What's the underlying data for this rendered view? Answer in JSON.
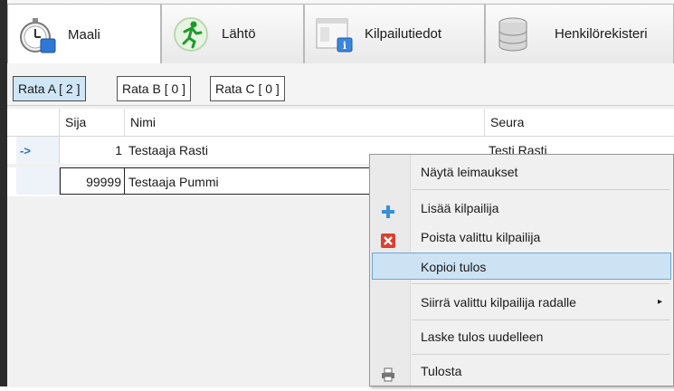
{
  "tabs": [
    {
      "label": "Maali",
      "icon": "stopwatch-icon",
      "active": true
    },
    {
      "label": "Lähtö",
      "icon": "runner-icon",
      "active": false
    },
    {
      "label": "Kilpailutiedot",
      "icon": "info-window-icon",
      "active": false
    },
    {
      "label": "Henkilörekisteri",
      "icon": "database-icon",
      "active": false
    }
  ],
  "rata_buttons": [
    {
      "label": "Rata A [ 2 ]",
      "selected": true
    },
    {
      "label": "Rata B [ 0 ]",
      "selected": false
    },
    {
      "label": "Rata C [ 0 ]",
      "selected": false
    }
  ],
  "grid": {
    "columns": [
      "Sija",
      "Nimi",
      "Seura"
    ],
    "rows": [
      {
        "marker": "->",
        "sija": "1",
        "nimi": "Testaaja Rasti",
        "seura": "Testi Rasti"
      },
      {
        "marker": "",
        "sija": "99999",
        "nimi": "Testaaja Pummi",
        "seura": ""
      }
    ]
  },
  "context_menu": {
    "items": [
      {
        "label": "Näytä leimaukset",
        "icon": ""
      },
      {
        "label": "Lisää kilpailija",
        "icon": "plus-icon"
      },
      {
        "label": "Poista valittu kilpailija",
        "icon": "delete-icon"
      },
      {
        "label": "Kopioi tulos",
        "icon": "",
        "highlighted": true
      },
      {
        "label": "Siirrä valittu kilpailija radalle",
        "icon": "",
        "submenu": true
      },
      {
        "label": "Laske tulos uudelleen",
        "icon": ""
      },
      {
        "label": "Tulosta",
        "icon": "printer-icon"
      }
    ],
    "submenu_arrow": "▸"
  },
  "colors": {
    "accent": "#2b6fd4",
    "highlight": "#cde3f4",
    "selected_tab_bg": "#ffffff"
  }
}
